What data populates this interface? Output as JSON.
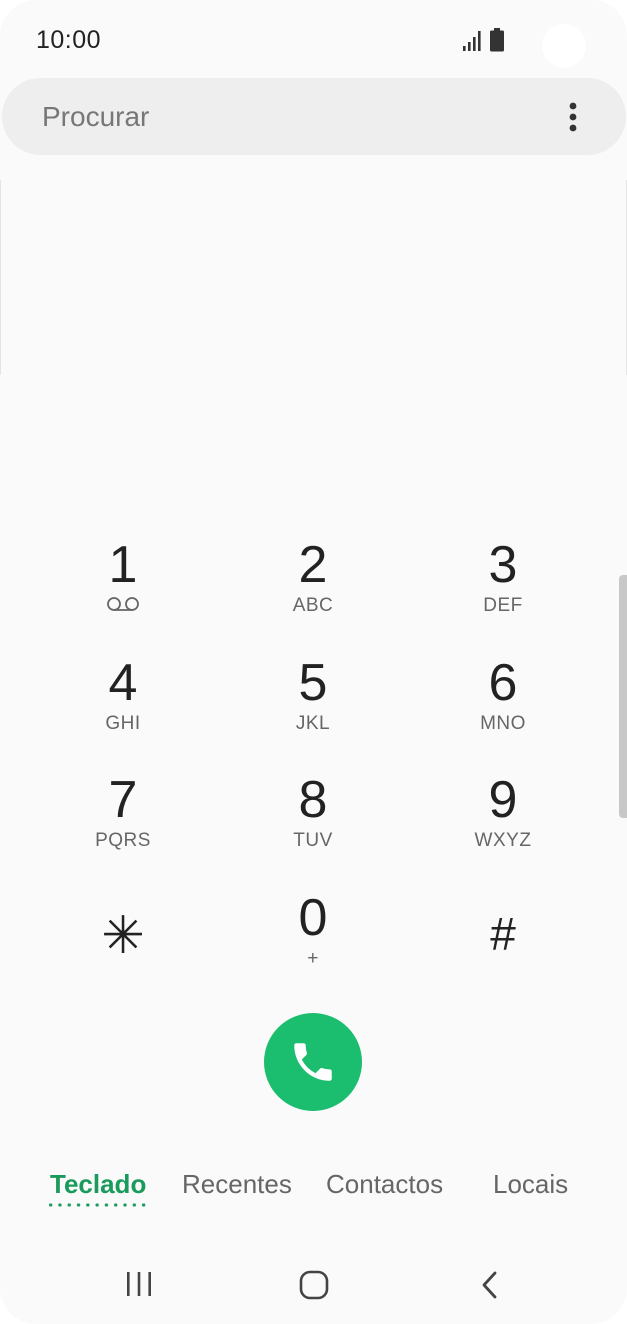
{
  "status_bar": {
    "time": "10:00",
    "icons": [
      "signal-icon",
      "battery-icon"
    ]
  },
  "search": {
    "placeholder": "Procurar",
    "menu_icon": "more-options-icon"
  },
  "keypad": {
    "keys": [
      {
        "digit": "1",
        "letters": "",
        "icon": "voicemail-icon"
      },
      {
        "digit": "2",
        "letters": "ABC"
      },
      {
        "digit": "3",
        "letters": "DEF"
      },
      {
        "digit": "4",
        "letters": "GHI"
      },
      {
        "digit": "5",
        "letters": "JKL"
      },
      {
        "digit": "6",
        "letters": "MNO"
      },
      {
        "digit": "7",
        "letters": "PQRS"
      },
      {
        "digit": "8",
        "letters": "TUV"
      },
      {
        "digit": "9",
        "letters": "WXYZ"
      },
      {
        "digit": "✳",
        "letters": ""
      },
      {
        "digit": "0",
        "letters": "+"
      },
      {
        "digit": "#",
        "letters": ""
      }
    ]
  },
  "call_button": {
    "icon": "phone-icon",
    "color": "#1bbd6e"
  },
  "tabs": [
    {
      "label": "Teclado",
      "active": true
    },
    {
      "label": "Recentes",
      "active": false
    },
    {
      "label": "Contactos",
      "active": false
    },
    {
      "label": "Locais",
      "active": false
    }
  ],
  "colors": {
    "accent": "#1a9a5b",
    "call_green": "#1bbd6e",
    "background": "#fafafa",
    "search_bg": "#eeeeee"
  },
  "nav_bar": {
    "icons": [
      "recent-apps-icon",
      "home-icon",
      "back-icon"
    ]
  }
}
